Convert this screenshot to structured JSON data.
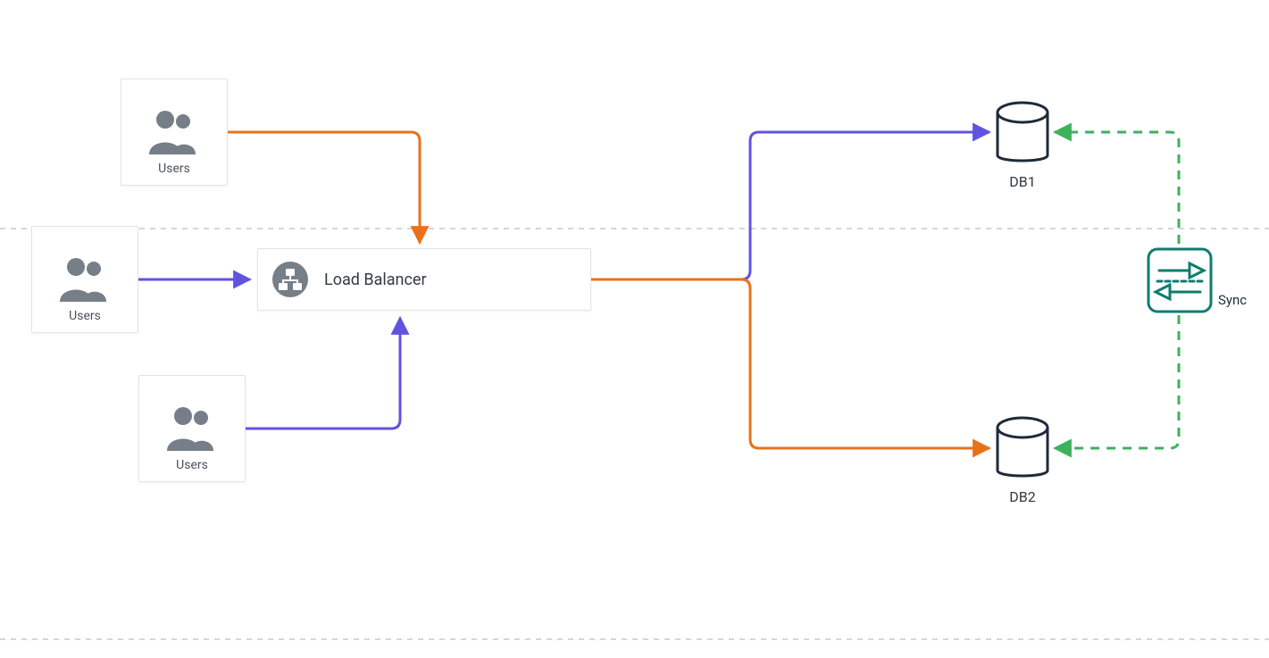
{
  "nodes": {
    "users1": {
      "label": "Users"
    },
    "users2": {
      "label": "Users"
    },
    "users3": {
      "label": "Users"
    },
    "loadBalancer": {
      "label": "Load Balancer"
    },
    "db1": {
      "label": "DB1"
    },
    "db2": {
      "label": "DB2"
    },
    "sync": {
      "label": "Sync"
    }
  },
  "colors": {
    "orange": "#e8721c",
    "purple": "#6153e0",
    "green": "#3cb25d",
    "teal": "#0d7d6f",
    "navy": "#1e2a3a",
    "iconGray": "#767e87",
    "dashGray": "#d4d7da"
  },
  "edges": [
    {
      "from": "users1",
      "to": "loadBalancer",
      "color": "orange",
      "style": "solid"
    },
    {
      "from": "users2",
      "to": "loadBalancer",
      "color": "purple",
      "style": "solid"
    },
    {
      "from": "users3",
      "to": "loadBalancer",
      "color": "purple",
      "style": "solid"
    },
    {
      "from": "loadBalancer",
      "to": "db1",
      "color": "purple",
      "style": "solid"
    },
    {
      "from": "loadBalancer",
      "to": "db2",
      "color": "orange",
      "style": "solid"
    },
    {
      "from": "sync",
      "to": "db1",
      "color": "green",
      "style": "dashed"
    },
    {
      "from": "sync",
      "to": "db2",
      "color": "green",
      "style": "dashed"
    }
  ]
}
